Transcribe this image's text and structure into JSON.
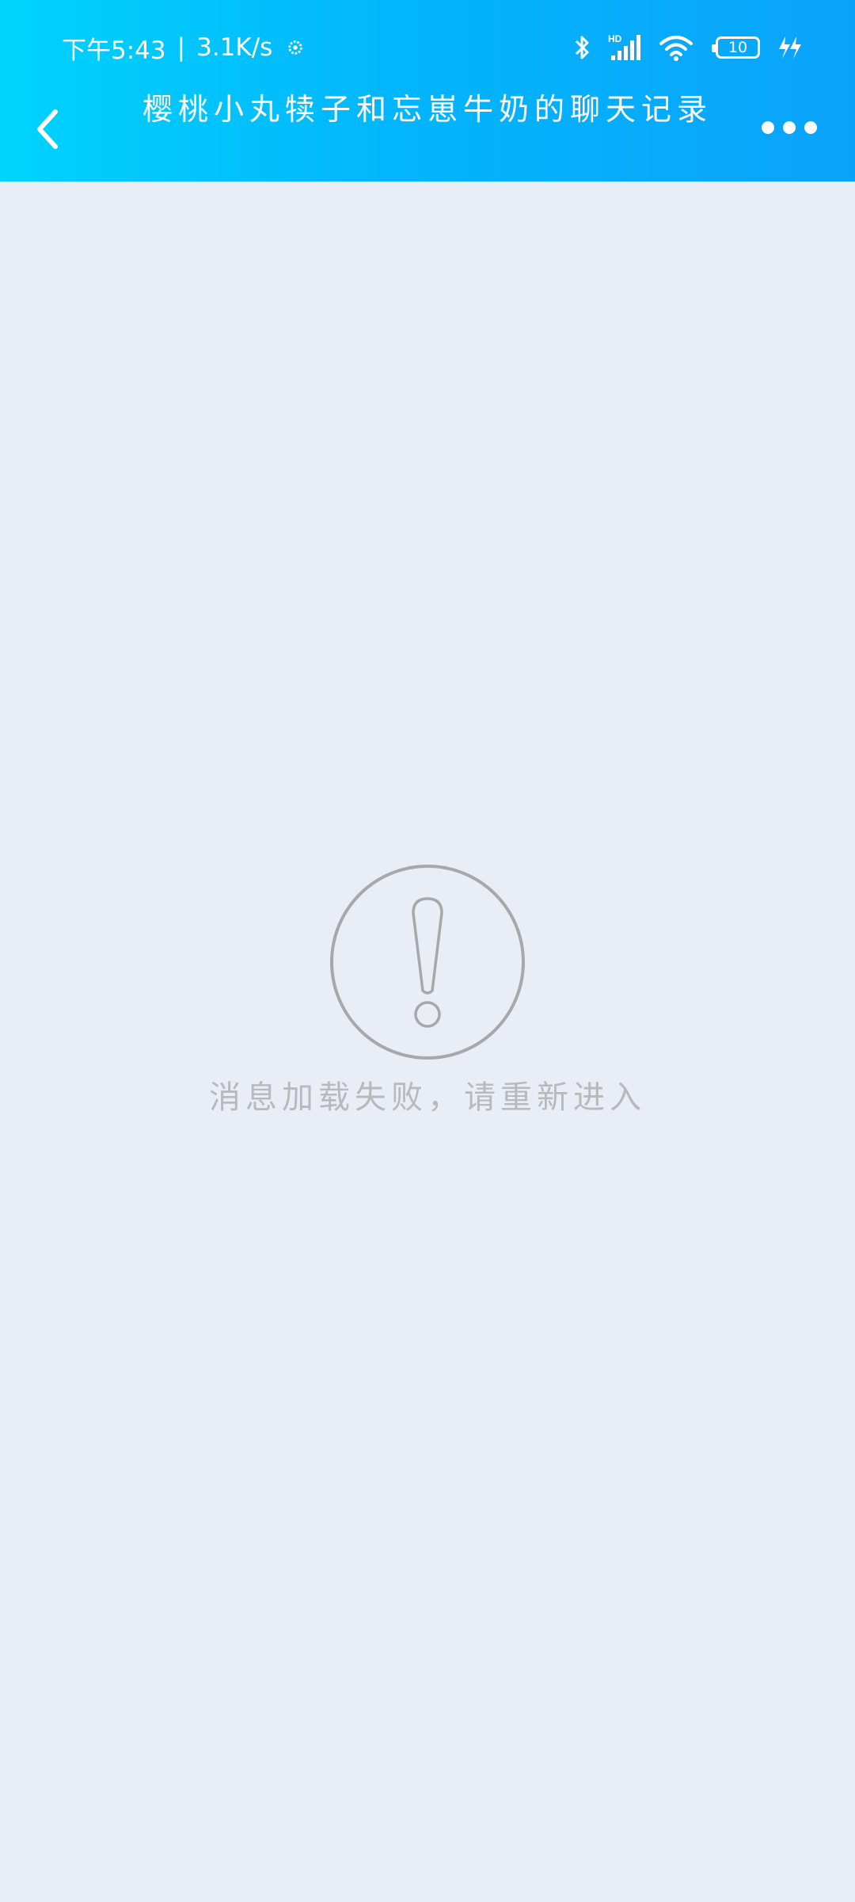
{
  "status_bar": {
    "time": "下午5:43",
    "separator": "|",
    "network_speed": "3.1K/s",
    "hd_label": "HD",
    "battery_level": "10",
    "icons": [
      "settings-gear-icon",
      "bluetooth-icon",
      "signal-icon",
      "wifi-icon",
      "battery-icon",
      "charging-icon"
    ]
  },
  "header": {
    "title": "樱桃小丸犊子和忘崽牛奶的聊天记录",
    "back_icon": "chevron-left-icon",
    "more_icon": "more-dots-icon"
  },
  "main": {
    "error_icon": "exclamation-circle-icon",
    "error_message": "消息加载失败，请重新进入"
  },
  "colors": {
    "header_gradient_start": "#00d3fd",
    "header_gradient_end": "#0aa3fb",
    "background": "#e9edf5",
    "error_icon": "#a6a8ad",
    "error_text": "#b7b9bf"
  }
}
